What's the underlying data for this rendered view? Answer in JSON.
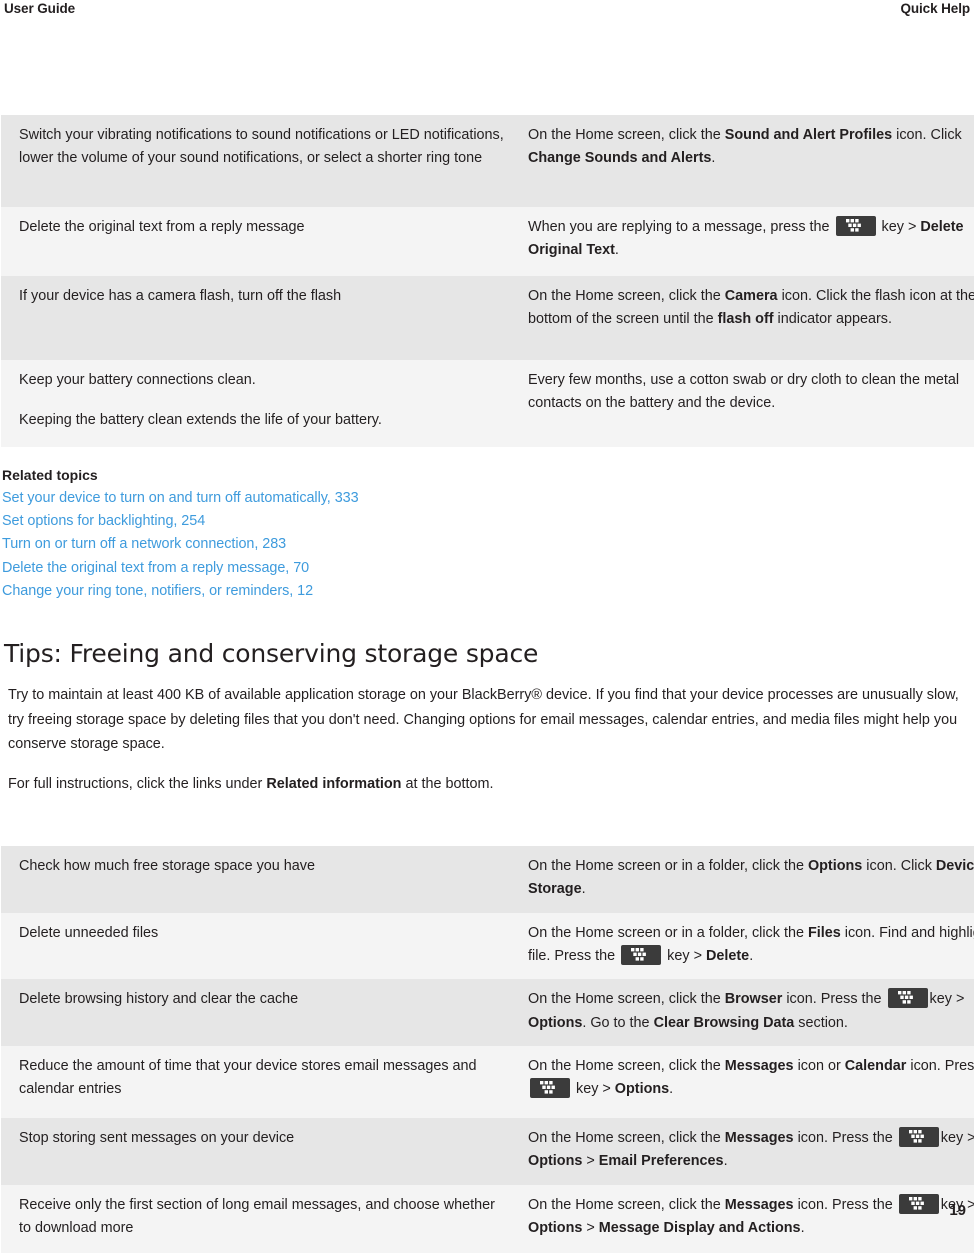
{
  "header": {
    "left_title": "User Guide",
    "right_title": "Quick Help"
  },
  "icons": {
    "menu_key": "blackberry-menu-key-icon"
  },
  "colors": {
    "link": "#3e9bdd",
    "text": "#231f20",
    "row_odd": "#e6e6e6",
    "row_even": "#f4f4f4",
    "key_icon": "#3b3b3b"
  },
  "table_battery": {
    "rows": [
      {
        "task": "Switch your vibrating notifications to sound notifications or LED notifications, lower the volume of your sound notifications, or select a shorter ring tone",
        "steps_pre": "On the Home screen, click the ",
        "steps_b1": "Sound and Alert Profiles",
        "steps_mid": " icon. Click ",
        "steps_b2": "Change Sounds and Alerts",
        "steps_post": "."
      },
      {
        "task": "Delete the original text from a reply message",
        "steps_pre": "When you are replying to a message, press the ",
        "steps_mid": " key > ",
        "steps_b2": "Delete Original Text",
        "steps_post": "."
      },
      {
        "task": "If your device has a camera flash, turn off the flash",
        "steps_pre": "On the Home screen, click the ",
        "steps_b1": "Camera",
        "steps_mid": " icon. Click the flash icon at the bottom of the screen until the ",
        "steps_b2": "flash off",
        "steps_post": " indicator appears."
      },
      {
        "task_line1": "Keep your battery connections clean.",
        "task_line2": "Keeping the battery clean extends the life of your battery.",
        "steps_pre": "Every few months, use a cotton swab or dry cloth to clean the metal contacts on the battery and the device."
      }
    ]
  },
  "related_topics": {
    "title": "Related topics",
    "links": [
      "Set your device to turn on and turn off automatically, 333",
      "Set options for backlighting, 254",
      "Turn on or turn off a network connection, 283",
      "Delete the original text from a reply message, 70",
      "Change your ring tone, notifiers, or reminders, 12"
    ]
  },
  "section": {
    "heading": "Tips: Freeing and conserving storage space",
    "intro_paragraph": "Try to maintain at least 400 KB of available application storage on your BlackBerry® device. If you find that your device processes are unusually slow, try freeing storage space by deleting files that you don't need. Changing options for email messages, calendar entries, and media files might help you conserve storage space.",
    "instructions_pre": "For full instructions, click the links under ",
    "instructions_bold": "Related information",
    "instructions_post": " at the bottom."
  },
  "table_storage": {
    "rows": [
      {
        "task": "Check how much free storage space you have",
        "steps_pre": "On the Home screen or in a folder, click the ",
        "steps_b1": "Options",
        "steps_mid": " icon. Click ",
        "steps_b2": "Device",
        "steps_sep": " > ",
        "steps_b3": "Storage",
        "steps_post": "."
      },
      {
        "task": "Delete unneeded files",
        "steps_pre": "On the Home screen or in a folder, click the ",
        "steps_b1": "Files",
        "steps_mid": " icon. Find and highlight a file. Press the ",
        "steps_after_key": " key > ",
        "steps_b2": "Delete",
        "steps_post": "."
      },
      {
        "task": "Delete browsing history and clear the cache",
        "steps_pre": "On the Home screen, click the ",
        "steps_b1": "Browser",
        "steps_mid": " icon. Press the ",
        "steps_after_key": "key > ",
        "steps_b2": "Options",
        "steps_sep": ". Go to the ",
        "steps_b3": "Clear Browsing Data",
        "steps_post": " section."
      },
      {
        "task": "Reduce the amount of time that your device stores email messages and calendar entries",
        "steps_pre": "On the Home screen, click the ",
        "steps_b1": "Messages",
        "steps_mid": " icon or ",
        "steps_b1b": "Calendar",
        "steps_mid2": " icon. Press the ",
        "steps_after_key": " key > ",
        "steps_b2": "Options",
        "steps_post": "."
      },
      {
        "task": "Stop storing sent messages on your device",
        "steps_pre": "On the Home screen, click the ",
        "steps_b1": "Messages",
        "steps_mid": " icon. Press the ",
        "steps_after_key": "key > ",
        "steps_b2": "Options",
        "steps_sep": " > ",
        "steps_b3": "Email Preferences",
        "steps_post": "."
      },
      {
        "task": "Receive only the first section of long email messages, and choose whether to download more",
        "steps_pre": "On the Home screen, click the ",
        "steps_b1": "Messages",
        "steps_mid": " icon. Press the ",
        "steps_after_key": "key > ",
        "steps_b2": "Options",
        "steps_sep": " > ",
        "steps_b3": "Message Display and Actions",
        "steps_post": "."
      }
    ]
  },
  "footer": {
    "page_number": "19"
  }
}
